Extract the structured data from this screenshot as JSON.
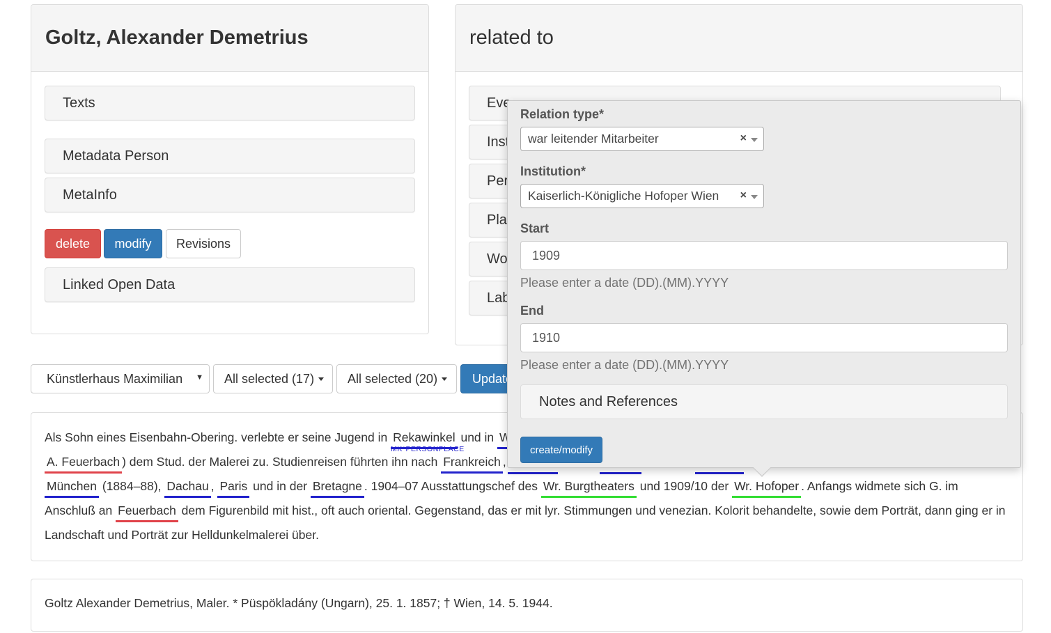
{
  "person_panel": {
    "title": "Goltz, Alexander Demetrius",
    "sections": [
      "Texts",
      "Metadata Person",
      "MetaInfo"
    ],
    "buttons": {
      "delete": "delete",
      "modify": "modify",
      "revisions": "Revisions"
    },
    "linked_open_data": "Linked Open Data"
  },
  "related_panel": {
    "title": "related to",
    "sections": [
      "Eve",
      "Inst",
      "Per",
      "Pla",
      "Wo",
      "Lab"
    ]
  },
  "filter_bar": {
    "collection_select": "Künstlerhaus Maximilian",
    "dropdown1": "All selected (17)",
    "dropdown2": "All selected (20)",
    "update_button": "Update"
  },
  "bio_text": {
    "line1": {
      "t1": "Als Sohn eines Eisenbahn-Obering. verlebte er seine Jugend in ",
      "a1": "Rekawinkel",
      "a1_tag": "MK*PERSONPLACE",
      "t2": " und in ",
      "a2": "W"
    },
    "line2": {
      "a1": "A. Feuerbach",
      "t1": ") dem Stud. der Malerei zu. Studienreisen führten ihn nach ",
      "a2": "Frankreich",
      "t2": ","
    },
    "line3": {
      "a1": "München",
      "t1": " (1884–88), ",
      "a2": "Dachau",
      "t2": ", ",
      "a3": "Paris",
      "t3": " und in der ",
      "a4": "Bretagne",
      "t4": ". 1904–07 Ausstattungschef des ",
      "a5": "Wr. Burgtheaters",
      "t5": " und 1909/10 der ",
      "a6": "Wr. Hofoper",
      "t6": ". Anfangs widmete sich G. im"
    },
    "line4": {
      "t1": "Anschluß an ",
      "a1": "Feuerbach",
      "t2": " dem Figurenbild mit hist., oft auch oriental. Gegenstand, das er mit lyr. Stimmungen und venezian. Kolorit behandelte, sowie dem Porträt, dann ging er in"
    },
    "line5": "Landschaft und Porträt zur Helldunkelmalerei über."
  },
  "short_bio": "Goltz Alexander Demetrius, Maler. * Püspökladány (Ungarn), 25. 1. 1857; † Wien, 14. 5. 1944.",
  "relation_form": {
    "relation_type_label": "Relation type*",
    "relation_type_value": "war leitender Mitarbeiter",
    "institution_label": "Institution*",
    "institution_value": "Kaiserlich-Königliche Hofoper Wien",
    "clear_glyph": "×",
    "start_label": "Start",
    "start_value": "1909",
    "start_help": "Please enter a date (DD).(MM).YYYY",
    "end_label": "End",
    "end_value": "1910",
    "end_help": "Please enter a date (DD).(MM).YYYY",
    "notes_label": "Notes and References",
    "submit_label": "create/modify"
  },
  "colors": {
    "danger": "#d9534f",
    "primary": "#337ab7",
    "annotation_place": "#2222cc",
    "annotation_person": "#e0434a",
    "annotation_institution": "#33dd33"
  }
}
